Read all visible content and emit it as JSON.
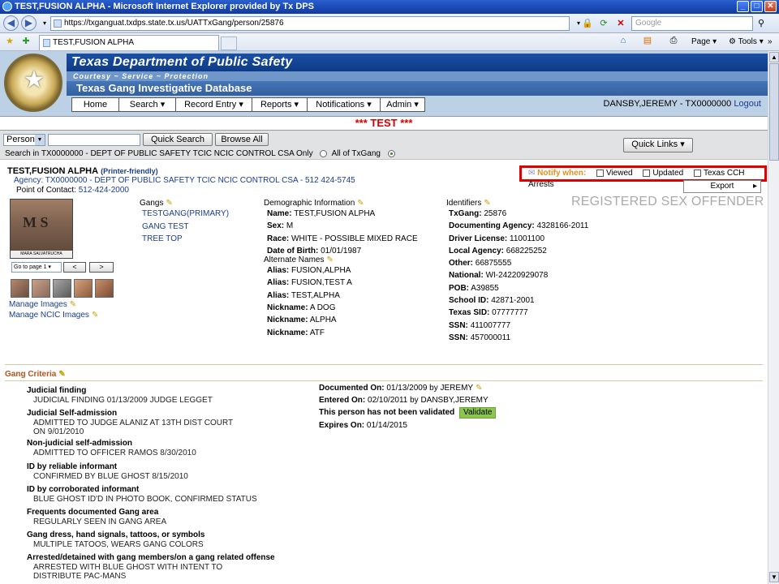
{
  "browser": {
    "window_title": "TEST,FUSION ALPHA - Microsoft Internet Explorer provided by Tx DPS",
    "url": "https://txganguat.txdps.state.tx.us/UATTxGang/person/25876",
    "search_placeholder": "Google",
    "tab_title": "TEST,FUSION ALPHA",
    "cmd_page": "Page",
    "cmd_tools": "Tools"
  },
  "banner": {
    "title": "Texas Department of Public Safety",
    "motto": "Courtesy  ~  Service  ~  Protection",
    "app_name": "Texas Gang Investigative Database",
    "seal_text": "TEXAS"
  },
  "menu": {
    "items": [
      "Home",
      "Search ▾",
      "Record Entry ▾",
      "Reports ▾",
      "Notifications ▾",
      "Admin ▾"
    ]
  },
  "user": {
    "name": "DANSBY,JEREMY - TX0000000",
    "logout": "Logout"
  },
  "env_banner": "*** TEST ***",
  "search": {
    "type_value": "Person",
    "quick_search_label": "Quick Search",
    "browse_all_label": "Browse All",
    "search_in_label": "Search in TX0000000 - DEPT OF PUBLIC SAFETY TCIC NCIC CONTROL CSA Only",
    "all_label": "All of TxGang",
    "quick_links_label": "Quick Links ▾"
  },
  "record": {
    "name": "TEST,FUSION ALPHA",
    "printer_friendly": "(Printer-friendly)",
    "agency": "Agency: TX0000000 - DEPT OF PUBLIC SAFETY TCIC NCIC CONTROL CSA - 512 424-5745",
    "point_of_contact_label": "Point of Contact:",
    "point_of_contact": "512-424-2000",
    "registered_flag": "REGISTERED SEX OFFENDER"
  },
  "notify": {
    "label": "Notify when:",
    "options": [
      "Viewed",
      "Updated",
      "Texas CCH Arrests"
    ]
  },
  "export_label": "Export",
  "photo": {
    "caption": "MARA SALVATRUCHA",
    "page_select": "Go to page 1",
    "prev": "<",
    "next": ">",
    "manage_images": "Manage Images",
    "manage_ncic_images": "Manage NCIC Images"
  },
  "gangs": {
    "title": "Gangs",
    "items": [
      "TESTGANG(PRIMARY)",
      "GANG TEST",
      "TREE TOP"
    ]
  },
  "demographic": {
    "title": "Demographic Information",
    "rows": [
      {
        "label": "Name:",
        "value": "TEST,FUSION ALPHA"
      },
      {
        "label": "Sex:",
        "value": "M"
      },
      {
        "label": "Race:",
        "value": "WHITE - POSSIBLE MIXED RACE"
      },
      {
        "label": "Date of Birth:",
        "value": "01/01/1987"
      }
    ]
  },
  "alternate_names": {
    "title": "Alternate Names",
    "rows": [
      {
        "label": "Alias:",
        "value": "FUSION,ALPHA"
      },
      {
        "label": "Alias:",
        "value": "FUSION,TEST A"
      },
      {
        "label": "Alias:",
        "value": "TEST,ALPHA"
      },
      {
        "label": "Nickname:",
        "value": "A DOG"
      },
      {
        "label": "Nickname:",
        "value": "ALPHA"
      },
      {
        "label": "Nickname:",
        "value": "ATF"
      }
    ]
  },
  "identifiers": {
    "title": "Identifiers",
    "rows": [
      {
        "label": "TxGang:",
        "value": "25876"
      },
      {
        "label": "Documenting Agency:",
        "value": "4328166-2011"
      },
      {
        "label": "Driver License:",
        "value": "11001100"
      },
      {
        "label": "Local Agency:",
        "value": "668225252"
      },
      {
        "label": "Other:",
        "value": "66875555"
      },
      {
        "label": "National:",
        "value": "WI-24220929078"
      },
      {
        "label": "POB:",
        "value": "A39855"
      },
      {
        "label": "School ID:",
        "value": "42871-2001"
      },
      {
        "label": "Texas SID:",
        "value": "07777777"
      },
      {
        "label": "SSN:",
        "value": "411007777"
      },
      {
        "label": "SSN:",
        "value": "457000011"
      }
    ]
  },
  "gang_criteria": {
    "title": "Gang Criteria",
    "items": [
      {
        "title": "Judicial finding",
        "detail": "JUDICIAL FINDING 01/13/2009 JUDGE LEGGET"
      },
      {
        "title": "Judicial Self-admission",
        "detail": "ADMITTED TO JUDGE ALANIZ AT 13TH DIST COURT ON 9/01/2010"
      },
      {
        "title": "Non-judicial self-admission",
        "detail": "ADMITTED TO OFFICER RAMOS 8/30/2010"
      },
      {
        "title": "ID by reliable informant",
        "detail": "CONFIRMED BY BLUE GHOST 8/15/2010"
      },
      {
        "title": "ID by corroborated informant",
        "detail": "BLUE GHOST ID'D IN PHOTO BOOK, CONFIRMED STATUS"
      },
      {
        "title": "Frequents documented Gang area",
        "detail": "REGULARLY SEEN IN GANG AREA"
      },
      {
        "title": "Gang dress, hand signals, tattoos, or symbols",
        "detail": "MULTIPLE TATOOS, WEARS GANG COLORS"
      },
      {
        "title": "Arrested/detained with gang members/on a gang related offense",
        "detail": "ARRESTED WITH BLUE GHOST WITH INTENT TO DISTRIBUTE PAC-MANS"
      }
    ],
    "documented_label": "Documented On:",
    "documented_value": "01/13/2009 by JEREMY",
    "entered_label": "Entered On:",
    "entered_value": "02/10/2011 by DANSBY,JEREMY",
    "not_validated": "This person has not been validated",
    "validate_label": "Validate",
    "expires_label": "Expires On:",
    "expires_value": "01/14/2015"
  }
}
